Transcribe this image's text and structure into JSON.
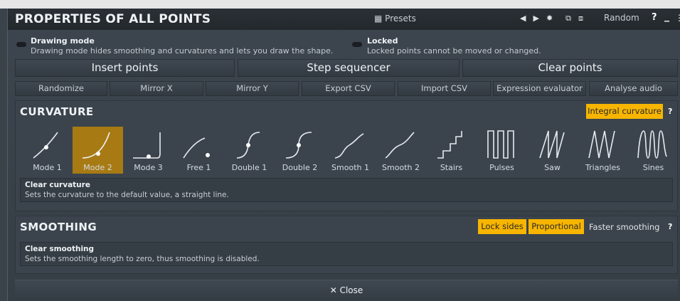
{
  "window": {
    "title": "PROPERTIES OF ALL POINTS",
    "presets_label": "Presets",
    "random_label": "Random",
    "help_label": "?",
    "minimize_label": "_",
    "more_label": "⋮"
  },
  "options": {
    "drawing_mode": {
      "title": "Drawing mode",
      "description": "Drawing mode hides smoothing and curvatures and lets you draw the shape."
    },
    "locked": {
      "title": "Locked",
      "description": "Locked points cannot be moved or changed."
    }
  },
  "actions": {
    "insert_points": "Insert points",
    "step_sequencer": "Step sequencer",
    "clear_points": "Clear points"
  },
  "tools": {
    "randomize": "Randomize",
    "mirror_x": "Mirror X",
    "mirror_y": "Mirror Y",
    "export_csv": "Export CSV",
    "import_csv": "Import CSV",
    "expression_evaluator": "Expression evaluator",
    "analyse_audio": "Analyse audio"
  },
  "curvature": {
    "title": "CURVATURE",
    "integral_label": "Integral curvature",
    "help_label": "?",
    "selected_mode": "Mode 2",
    "modes": [
      {
        "label": "Mode 1",
        "icon": "mode1-curve-icon"
      },
      {
        "label": "Mode 2",
        "icon": "mode2-curve-icon"
      },
      {
        "label": "Mode 3",
        "icon": "mode3-curve-icon"
      },
      {
        "label": "Free 1",
        "icon": "free1-curve-icon"
      },
      {
        "label": "Double 1",
        "icon": "double1-curve-icon"
      },
      {
        "label": "Double 2",
        "icon": "double2-curve-icon"
      },
      {
        "label": "Smooth 1",
        "icon": "smooth1-curve-icon"
      },
      {
        "label": "Smooth 2",
        "icon": "smooth2-curve-icon"
      },
      {
        "label": "Stairs",
        "icon": "stairs-curve-icon"
      },
      {
        "label": "Pulses",
        "icon": "pulses-curve-icon"
      },
      {
        "label": "Saw",
        "icon": "saw-curve-icon"
      },
      {
        "label": "Triangles",
        "icon": "triangles-curve-icon"
      },
      {
        "label": "Sines",
        "icon": "sines-curve-icon"
      }
    ],
    "info_title": "Clear curvature",
    "info_description": "Sets the curvature to the default value, a straight line."
  },
  "smoothing": {
    "title": "SMOOTHING",
    "lock_sides_label": "Lock sides",
    "proportional_label": "Proportional",
    "faster_label": "Faster smoothing",
    "help_label": "?",
    "info_title": "Clear smoothing",
    "info_description": "Sets the smoothing length to zero, thus smoothing is disabled."
  },
  "footer": {
    "close_label": "✕ Close"
  },
  "colors": {
    "accent": "#f7b500",
    "selected_mode": "#a77a14",
    "background": "#3d464f"
  }
}
